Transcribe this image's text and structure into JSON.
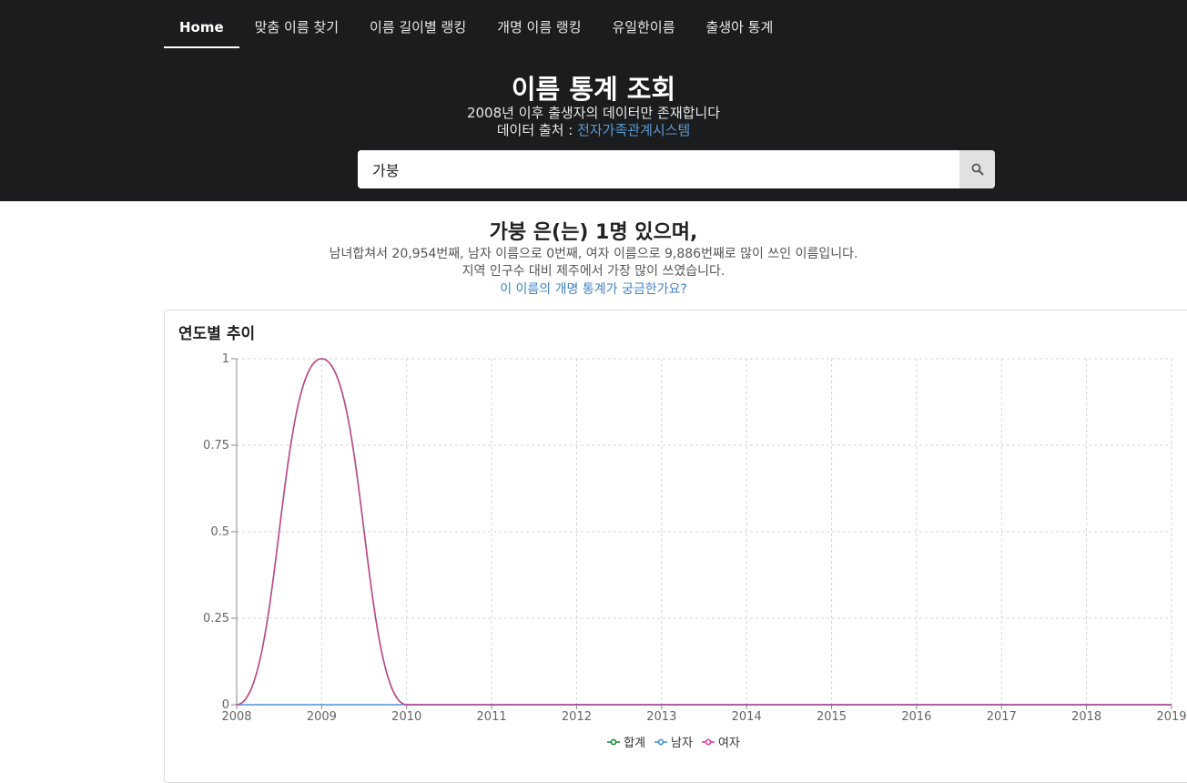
{
  "nav": {
    "items": [
      {
        "label": "Home",
        "active": true
      },
      {
        "label": "맞춤 이름 찾기",
        "active": false
      },
      {
        "label": "이름 길이별 랭킹",
        "active": false
      },
      {
        "label": "개명 이름 랭킹",
        "active": false
      },
      {
        "label": "유일한이름",
        "active": false
      },
      {
        "label": "출생아 통계",
        "active": false
      }
    ]
  },
  "hero": {
    "title": "이름 통계 조회",
    "subtitle": "2008년 이후 출생자의 데이터만 존재합니다",
    "source_label": "데이터 출처 : ",
    "source_link": "전자가족관계시스템"
  },
  "search": {
    "value": "가붕",
    "icon": "search-icon"
  },
  "summary": {
    "title": "가붕 은(는) 1명 있으며,",
    "line1": "남녀합쳐서 20,954번째, 남자 이름으로 0번째, 여자 이름으로 9,886번째로 많이 쓰인 이름입니다.",
    "line2": "지역 인구수 대비 제주에서 가장 많이 쓰였습니다.",
    "link": "이 이름의 개명 통계가 궁금한가요?"
  },
  "card": {
    "title": "연도별 추이"
  },
  "colors": {
    "topbar": "#1b1c1d",
    "link": "#4183c4",
    "total": "#0a8a2a",
    "male": "#3a8fd9",
    "female": "#e0329a"
  },
  "chart_data": {
    "type": "line",
    "x": [
      "2008",
      "2009",
      "2010",
      "2011",
      "2012",
      "2013",
      "2014",
      "2015",
      "2016",
      "2017",
      "2018",
      "2019"
    ],
    "ylim": [
      0,
      1
    ],
    "yticks": [
      "0",
      "0.25",
      "0.5",
      "0.75",
      "1"
    ],
    "grid": true,
    "legend_position": "bottom",
    "series": [
      {
        "name": "합계",
        "color": "#0a8a2a",
        "values": [
          0,
          1,
          0,
          0,
          0,
          0,
          0,
          0,
          0,
          0,
          0,
          0
        ]
      },
      {
        "name": "남자",
        "color": "#3a8fd9",
        "values": [
          0,
          0,
          0,
          0,
          0,
          0,
          0,
          0,
          0,
          0,
          0,
          0
        ]
      },
      {
        "name": "여자",
        "color": "#e0329a",
        "values": [
          0,
          1,
          0,
          0,
          0,
          0,
          0,
          0,
          0,
          0,
          0,
          0
        ]
      }
    ]
  }
}
